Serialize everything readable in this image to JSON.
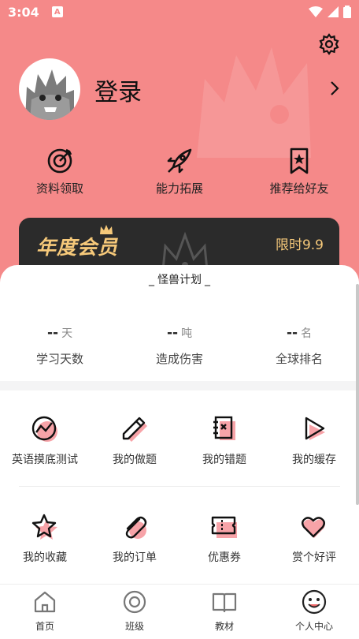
{
  "status_bar": {
    "time": "3:04",
    "notification": "A"
  },
  "profile": {
    "login_label": "登录"
  },
  "quick_actions": [
    {
      "label": "资料领取",
      "icon": "target-icon"
    },
    {
      "label": "能力拓展",
      "icon": "rocket-icon"
    },
    {
      "label": "推荐给好友",
      "icon": "bookmark-star-icon"
    }
  ],
  "vip_banner": {
    "title": "年度会员",
    "price": "限时9.9"
  },
  "plan": {
    "title": "怪兽计划"
  },
  "stats": [
    {
      "value": "--",
      "unit": "天",
      "label": "学习天数"
    },
    {
      "value": "--",
      "unit": "吨",
      "label": "造成伤害"
    },
    {
      "value": "--",
      "unit": "名",
      "label": "全球排名"
    }
  ],
  "grid_row1": [
    {
      "label": "英语摸底测试",
      "icon": "trend-circle-icon"
    },
    {
      "label": "我的做题",
      "icon": "pencil-icon"
    },
    {
      "label": "我的错题",
      "icon": "notebook-x-icon"
    },
    {
      "label": "我的缓存",
      "icon": "play-icon"
    }
  ],
  "grid_row2": [
    {
      "label": "我的收藏",
      "icon": "star-icon"
    },
    {
      "label": "我的订单",
      "icon": "paperclip-icon"
    },
    {
      "label": "优惠券",
      "icon": "ticket-icon"
    },
    {
      "label": "赏个好评",
      "icon": "heart-icon"
    }
  ],
  "tabs": [
    {
      "label": "首页",
      "icon": "home-icon"
    },
    {
      "label": "班级",
      "icon": "disc-icon"
    },
    {
      "label": "教材",
      "icon": "book-icon"
    },
    {
      "label": "个人中心",
      "icon": "monster-face-icon"
    }
  ],
  "colors": {
    "header": "#f58989",
    "accent_pink": "#f7a3a8",
    "vip_bg": "#2b2b2b",
    "vip_gold": "#f6c97a"
  }
}
